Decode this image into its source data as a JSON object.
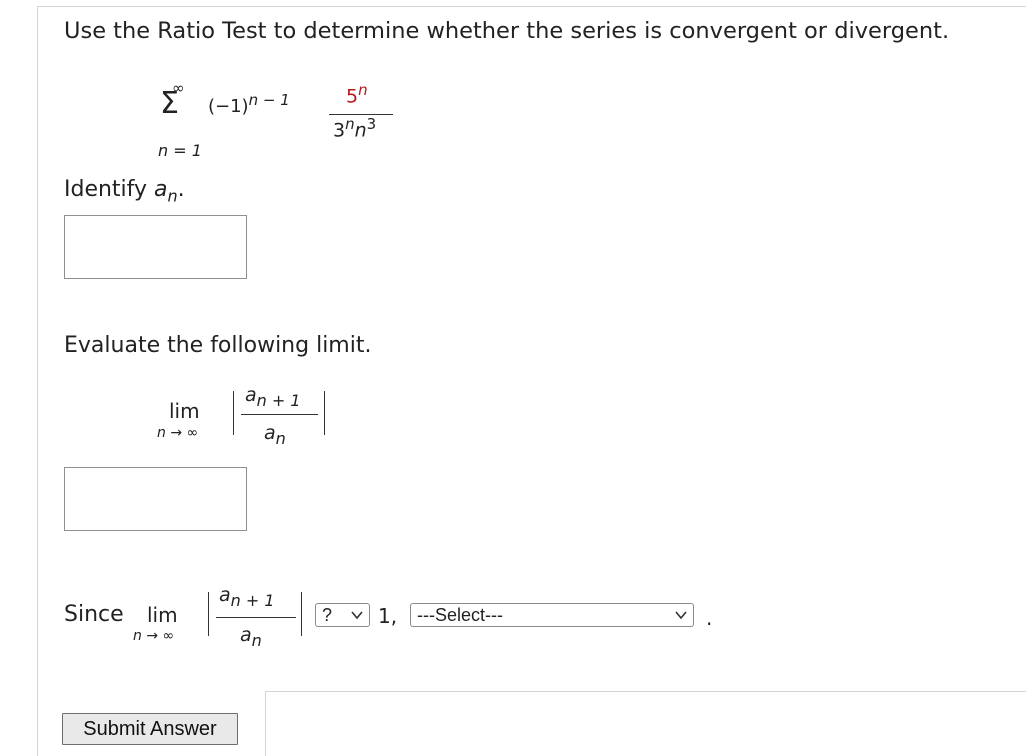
{
  "question": {
    "prompt": "Use the Ratio Test to determine whether the series is convergent or divergent."
  },
  "series": {
    "upper_limit": "∞",
    "sigma": "Σ",
    "lower_limit": "n = 1",
    "sign_base": "(−1)",
    "sign_exp": "n − 1",
    "num_base": "5",
    "num_exp": "n",
    "den_base1": "3",
    "den_exp1": "n",
    "den_base2": "n",
    "den_exp2": "3",
    "highlight_color": "#b31b1b"
  },
  "identify": {
    "label": "Identify ",
    "var": "a",
    "sub": "n",
    "suffix": ".",
    "answer_value": ""
  },
  "evaluate": {
    "label": "Evaluate the following limit.",
    "lim": "lim",
    "lim_sub": "n → ∞",
    "num_var": "a",
    "num_sub": "n + 1",
    "den_var": "a",
    "den_sub": "n",
    "answer_value": ""
  },
  "conclusion": {
    "since": "Since",
    "lim": "lim",
    "lim_sub": "n → ∞",
    "num_var": "a",
    "num_sub": "n + 1",
    "den_var": "a",
    "den_sub": "n",
    "compare_selected": "?",
    "one": "1,",
    "result_selected": "---Select---",
    "period": "."
  },
  "submit": {
    "label": "Submit Answer"
  },
  "icons": {
    "dropdown": "chevron-down-icon"
  }
}
